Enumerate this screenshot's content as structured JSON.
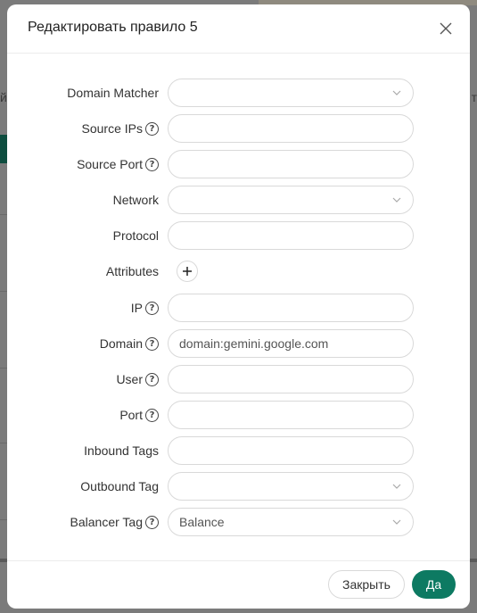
{
  "modal": {
    "title": "Редактировать правило 5"
  },
  "form": {
    "domain_matcher": {
      "label": "Domain Matcher",
      "value": ""
    },
    "source_ips": {
      "label": "Source IPs",
      "value": ""
    },
    "source_port": {
      "label": "Source Port",
      "value": ""
    },
    "network": {
      "label": "Network",
      "value": ""
    },
    "protocol": {
      "label": "Protocol",
      "value": ""
    },
    "attributes": {
      "label": "Attributes"
    },
    "ip": {
      "label": "IP",
      "value": ""
    },
    "domain": {
      "label": "Domain",
      "value": "domain:gemini.google.com"
    },
    "user": {
      "label": "User",
      "value": ""
    },
    "port": {
      "label": "Port",
      "value": ""
    },
    "inbound_tags": {
      "label": "Inbound Tags",
      "value": ""
    },
    "outbound_tag": {
      "label": "Outbound Tag",
      "value": ""
    },
    "balancer_tag": {
      "label": "Balancer Tag",
      "value": "Balance"
    }
  },
  "footer": {
    "cancel_label": "Закрыть",
    "ok_label": "Да"
  },
  "background": {
    "left_fragment": "й",
    "right_fragment": "т"
  },
  "colors": {
    "accent": "#0d7a62",
    "border": "#d9d9d9"
  },
  "icons": {
    "close": "close-icon",
    "help": "question-circle-icon",
    "chevron": "chevron-down-icon",
    "plus": "plus-icon"
  }
}
